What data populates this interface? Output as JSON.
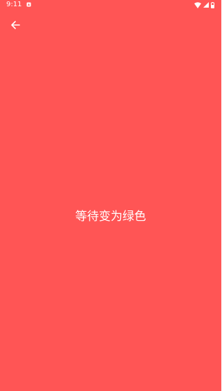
{
  "status_bar": {
    "time": "9:11",
    "icons": [
      "notification-icon",
      "wifi-icon",
      "signal-icon",
      "battery-icon"
    ]
  },
  "toolbar": {
    "back_icon": "arrow-left-icon"
  },
  "main": {
    "message": "等待变为绿色"
  },
  "colors": {
    "background": "#ff5555",
    "foreground": "#ffffff"
  }
}
